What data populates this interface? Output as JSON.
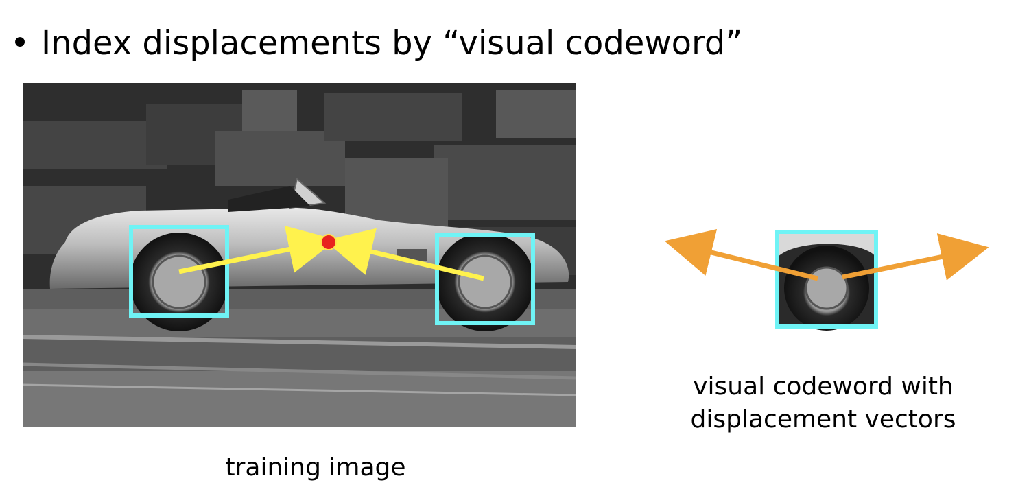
{
  "slide": {
    "bullet_symbol": "•",
    "title": "Index displacements by “visual codeword”"
  },
  "left_panel": {
    "caption": "training image",
    "image_content": "grayscale photo of a vintage roadster car parked by a stone wall"
  },
  "right_panel": {
    "caption_line1": "visual codeword with",
    "caption_line2": "displacement vectors",
    "image_content": "cropped wheel patch"
  },
  "colors": {
    "patch_box": "#6FF3F5",
    "vote_arrow": "#FFF24D",
    "center_point": "#E8231E",
    "displacement_arrow": "#F0A035",
    "text": "#000000"
  },
  "icons": {
    "bullet": "bullet-dot-icon",
    "arrow": "arrow-icon"
  }
}
